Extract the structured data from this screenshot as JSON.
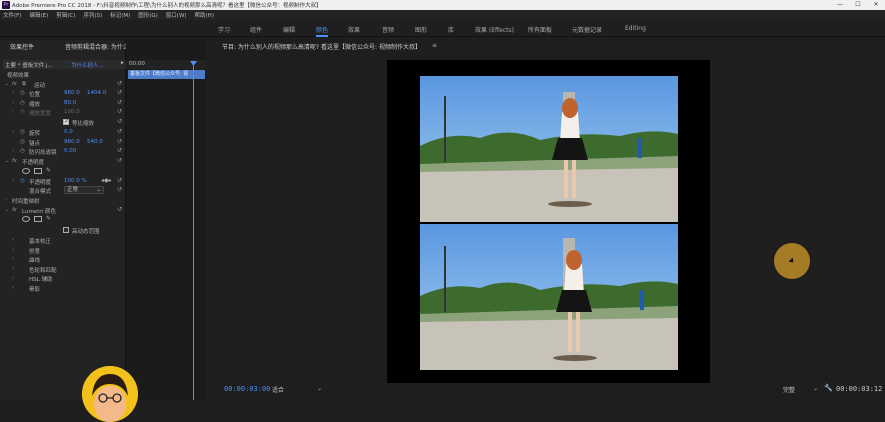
{
  "window": {
    "title": "Adobe Premiere Pro CC 2018 - F:\\抖音视频制作\\工程\\为什么别人的视频那么高清呢？看这里【微信公众号：视频制作大叔】",
    "minimize": "—",
    "maximize": "☐",
    "close": "✕"
  },
  "menu": [
    "文件(F)",
    "编辑(E)",
    "剪辑(C)",
    "序列(S)",
    "标记(M)",
    "图形(G)",
    "窗口(W)",
    "帮助(H)"
  ],
  "workspaces": [
    {
      "label": "学习",
      "active": false
    },
    {
      "label": "组件",
      "active": false
    },
    {
      "label": "编辑",
      "active": false
    },
    {
      "label": "颜色",
      "active": true
    },
    {
      "label": "效果",
      "active": false
    },
    {
      "label": "音频",
      "active": false
    },
    {
      "label": "图形",
      "active": false
    },
    {
      "label": "库",
      "active": false
    },
    {
      "label": "效果 (Effects)",
      "active": false
    },
    {
      "label": "所有面板",
      "active": false
    },
    {
      "label": "元数据记录",
      "active": false
    },
    {
      "label": "Editing",
      "active": false
    }
  ],
  "left_panel": {
    "tab_effects": "效果控件",
    "tab_audio": "音频剪辑混合器: 为什么别人的视频那么高清呢? 看这里【微信公众号: 视频制作大叔】",
    "source_label": "主要 * 垂板文件.j...",
    "source_clip": "为什么别人...",
    "timeline_time": "00:00",
    "clip_name": "垂板文件【微信公众号: 视",
    "section_video": "视频效果",
    "rows": [
      {
        "label": "运动",
        "type": "fx"
      },
      {
        "label": "位置",
        "v1": "960.0",
        "v2": "1404.0"
      },
      {
        "label": "缩放",
        "v1": "80.0",
        "v2": ""
      },
      {
        "label": "缩放宽度",
        "v1": "100.0",
        "v2": "",
        "dim": true
      },
      {
        "label": "等比缩放",
        "type": "checkbox"
      },
      {
        "label": "旋转",
        "v1": "0.0",
        "v2": ""
      },
      {
        "label": "锚点",
        "v1": "960.0",
        "v2": "540.0"
      },
      {
        "label": "防闪烁滤镜",
        "v1": "0.00",
        "v2": ""
      },
      {
        "label": "不透明度",
        "type": "fx"
      },
      {
        "label": "",
        "type": "shapes"
      },
      {
        "label": "不透明度",
        "v1": "100.0 %",
        "v2": ""
      },
      {
        "label": "混合模式",
        "select": "正常"
      },
      {
        "label": "时间重映射",
        "type": "section"
      },
      {
        "label": "Lumetri 颜色",
        "type": "fx"
      },
      {
        "label": "",
        "type": "shapes"
      },
      {
        "label": "高动态范围",
        "type": "checkbox"
      },
      {
        "label": "基本校正",
        "type": "section"
      },
      {
        "label": "创意",
        "type": "section"
      },
      {
        "label": "曲线",
        "type": "section"
      },
      {
        "label": "色轮和匹配",
        "type": "section"
      },
      {
        "label": "HSL 辅助",
        "type": "section"
      },
      {
        "label": "晕影",
        "type": "section"
      }
    ]
  },
  "program": {
    "tab": "节目: 为什么别人的视频那么高清呢? 看这里【微信公众号: 视频制作大叔】",
    "timecode_left": "00:00:03:00",
    "fit": "适合",
    "quality": "完整",
    "timecode_right": "00:00:03:12"
  },
  "colors": {
    "accent": "#4f8ef7",
    "clip": "#4d7cc9",
    "cursor": "#be8c28"
  }
}
